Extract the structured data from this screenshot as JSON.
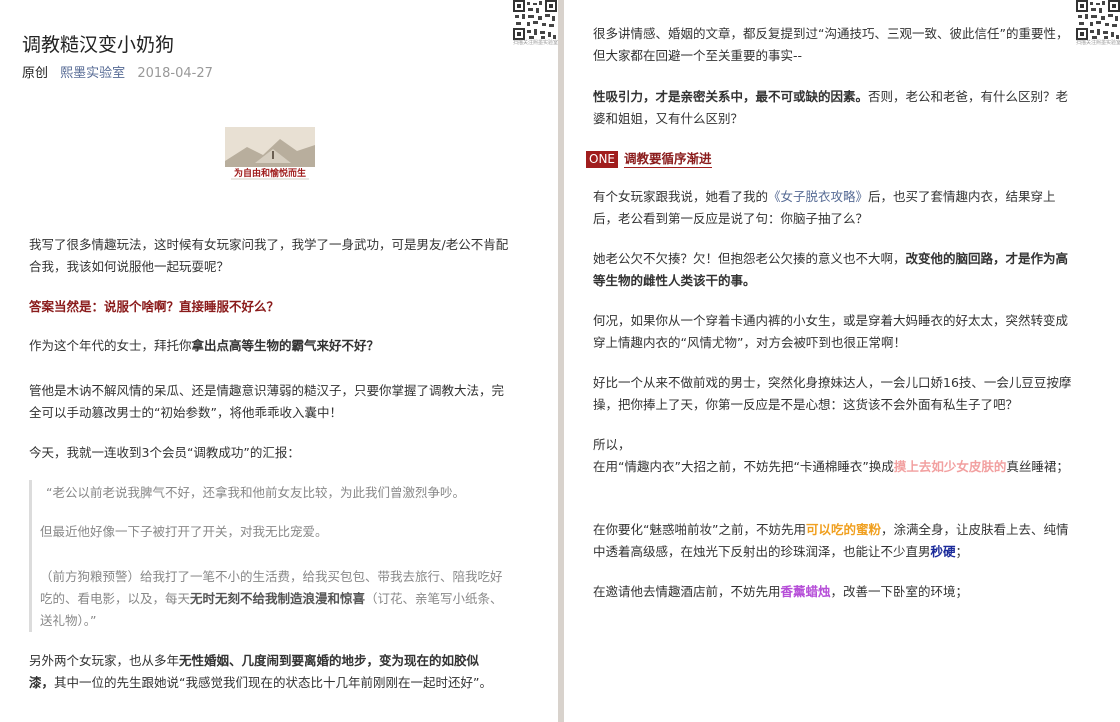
{
  "left": {
    "title": "调教糙汉变小奶狗",
    "meta": {
      "original": "原创",
      "author": "熙墨实验室",
      "date": "2018-04-27"
    },
    "banner_caption": "为自由和愉悦而生",
    "qr_caption": "扫描关注熙墨实验室",
    "p1": "我写了很多情趣玩法，这时候有女玩家问我了，我学了一身武功，可是男友/老公不肯配合我，我该如何说服他一起玩耍呢？",
    "p2": "答案当然是：说服个啥啊？直接睡服不好么？",
    "p3_a": "作为这个年代的女士，拜托你",
    "p3_b": "拿出点高等生物的霸气来好不好？",
    "p4": "管他是木讷不解风情的呆瓜、还是情趣意识薄弱的糙汉子，只要你掌握了调教大法，完全可以手动篡改男士的“初始参数”，将他乖乖收入囊中！",
    "p5": "今天，我就一连收到3个会员“调教成功”的汇报：",
    "q1": "“老公以前老说我脾气不好，还拿我和他前女友比较，为此我们曾激烈争吵。",
    "q2": "但最近他好像一下子被打开了开关，对我无比宠爱。",
    "q3_a": "（前方狗粮预警）给我打了一笔不小的生活费，给我买包包、带我去旅行、陪我吃好吃的、看电影，以及，每天",
    "q3_b": "无时无刻不给我制造浪漫和惊喜",
    "q3_c": "（订花、亲笔写小纸条、送礼物）。”",
    "p6_a": "另外两个女玩家，也从多年",
    "p6_b": "无性婚姻、几度闹到要离婚的地步，变为现在的如胶似漆，",
    "p6_c": "其中一位的先生跟她说“我感觉我们现在的状态比十几年前刚刚在一起时还好”。"
  },
  "right": {
    "qr_caption": "扫描关注熙墨实验室",
    "r1": "很多讲情感、婚姻的文章，都反复提到过“沟通技巧、三观一致、彼此信任”的重要性，但大家都在回避一个至关重要的事实--",
    "r2_a": "性吸引力，才是亲密关系中，最不可或缺的因素。",
    "r2_b": "否则，老公和老爸，有什么区别？老婆和姐姐，又有什么区别？",
    "section_tag": "ONE",
    "section_label": "调教要循序渐进",
    "r3_a": "有个女玩家跟我说，她看了我的",
    "r3_link": "《女子脱衣攻略》",
    "r3_b": "后，也买了套情趣内衣，结果穿上后，老公看到第一反应是说了句：你脑子抽了么？",
    "r4_a": "她老公欠不欠揍？欠！但抱怨老公欠揍的意义也不大啊，",
    "r4_b": "改变他的脑回路，才是作为高等生物的雌性人类该干的事。",
    "r5": "何况，如果你从一个穿着卡通内裤的小女生，或是穿着大妈睡衣的好太太，突然转变成穿上情趣内衣的“风情尤物”，对方会被吓到也很正常啊！",
    "r6": "好比一个从来不做前戏的男士，突然化身撩妹达人，一会儿口娇16技、一会儿豆豆按摩操，把你捧上了天，你第一反应是不是心想：这货该不会外面有私生子了吧？",
    "r7_line1": "所以，",
    "r7_a": "在用“情趣内衣”大招之前，不妨先把“卡通棉睡衣”换成",
    "r7_b": "摸上去如少女皮肤的",
    "r7_c": "真丝睡裙；",
    "r8_a": "在你要化“魅惑啪前妆”之前，不妨先用",
    "r8_b": "可以吃的蜜粉",
    "r8_c": "，涂满全身，让皮肤看上去、纯情中透着高级感，在烛光下反射出的珍珠润泽，也能让不少直男",
    "r8_d": "秒硬",
    "r8_e": "；",
    "r9_a": "在邀请他去情趣酒店前，不妨先用",
    "r9_b": "香薰蜡烛",
    "r9_c": "，改善一下卧室的环境；"
  }
}
